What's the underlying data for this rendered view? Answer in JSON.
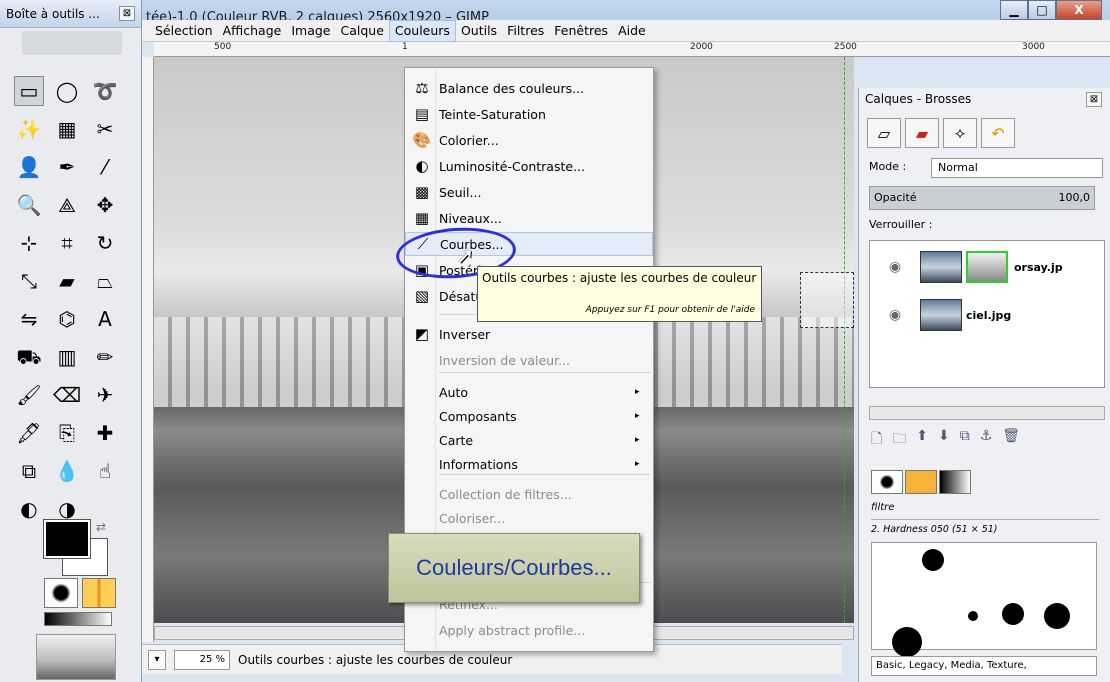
{
  "toolbox": {
    "title": "Boîte à outils ...",
    "close_glyph": "⊠",
    "tools": [
      {
        "name": "rect-select-icon",
        "glyph": "▭",
        "selected": true
      },
      {
        "name": "ellipse-select-icon",
        "glyph": "◯"
      },
      {
        "name": "lasso-icon",
        "glyph": "➰"
      },
      {
        "name": "fuzzy-select-icon",
        "glyph": "✨"
      },
      {
        "name": "color-select-icon",
        "glyph": "▦"
      },
      {
        "name": "scissors-icon",
        "glyph": "✂"
      },
      {
        "name": "foreground-select-icon",
        "glyph": "👤"
      },
      {
        "name": "paths-icon",
        "glyph": "✒"
      },
      {
        "name": "color-picker-icon",
        "glyph": "⁄"
      },
      {
        "name": "zoom-icon",
        "glyph": "🔍"
      },
      {
        "name": "measure-icon",
        "glyph": "⟁"
      },
      {
        "name": "move-icon",
        "glyph": "✥"
      },
      {
        "name": "align-icon",
        "glyph": "⊹"
      },
      {
        "name": "crop-icon",
        "glyph": "⌗"
      },
      {
        "name": "rotate-icon",
        "glyph": "↻"
      },
      {
        "name": "scale-icon",
        "glyph": "⤡"
      },
      {
        "name": "shear-icon",
        "glyph": "▰"
      },
      {
        "name": "perspective-icon",
        "glyph": "⏢"
      },
      {
        "name": "flip-icon",
        "glyph": "⇋"
      },
      {
        "name": "cage-icon",
        "glyph": "⌬"
      },
      {
        "name": "text-icon",
        "glyph": "A"
      },
      {
        "name": "bucket-fill-icon",
        "glyph": "⛟"
      },
      {
        "name": "blend-icon",
        "glyph": "▥"
      },
      {
        "name": "pencil-icon",
        "glyph": "✏"
      },
      {
        "name": "paintbrush-icon",
        "glyph": "🖌"
      },
      {
        "name": "eraser-icon",
        "glyph": "⌫"
      },
      {
        "name": "airbrush-icon",
        "glyph": "✈"
      },
      {
        "name": "ink-icon",
        "glyph": "🖋"
      },
      {
        "name": "clone-icon",
        "glyph": "⎘"
      },
      {
        "name": "heal-icon",
        "glyph": "✚"
      },
      {
        "name": "perspective-clone-icon",
        "glyph": "⧉"
      },
      {
        "name": "blur-icon",
        "glyph": "💧"
      },
      {
        "name": "smudge-icon",
        "glyph": "☝"
      },
      {
        "name": "dodge-burn-icon",
        "glyph": "◐"
      },
      {
        "name": "extra-tool-icon",
        "glyph": "◑"
      }
    ]
  },
  "window": {
    "title": "tée)-1.0 (Couleur RVB, 2 calques) 2560x1920 – GIMP",
    "minimize": "▁",
    "maximize": "□",
    "close": "X"
  },
  "menubar": [
    "Sélection",
    "Affichage",
    "Image",
    "Calque",
    "Couleurs",
    "Outils",
    "Filtres",
    "Fenêtres",
    "Aide"
  ],
  "ruler": {
    "labels": [
      "500",
      "1",
      "2000",
      "2500",
      "3000"
    ]
  },
  "colors_menu": {
    "items": [
      {
        "icon": "balance-icon",
        "glyph": "⚖",
        "label": "Balance des couleurs..."
      },
      {
        "icon": "hue-sat-icon",
        "glyph": "▤",
        "label": "Teinte-Saturation"
      },
      {
        "icon": "colorize-icon",
        "glyph": "🎨",
        "label": "Colorier..."
      },
      {
        "icon": "brightness-icon",
        "glyph": "◐",
        "label": "Luminosité-Contraste..."
      },
      {
        "icon": "threshold-icon",
        "glyph": "▩",
        "label": "Seuil..."
      },
      {
        "icon": "levels-icon",
        "glyph": "▦",
        "label": "Niveaux..."
      },
      {
        "icon": "curves-icon",
        "glyph": "⟋",
        "label": "Courbes...",
        "highlight": true
      },
      {
        "icon": "posterize-icon",
        "glyph": "▣",
        "label": "Postériser..."
      },
      {
        "icon": "desaturate-icon",
        "glyph": "▧",
        "label": "Désaturer..."
      },
      {
        "icon": "invert-icon",
        "glyph": "◩",
        "label": "Inverser"
      },
      {
        "icon": "",
        "glyph": "",
        "label": "Inversion de valeur...",
        "disabled": true
      },
      {
        "icon": "",
        "glyph": "",
        "label": "Auto",
        "submenu": true
      },
      {
        "icon": "",
        "glyph": "",
        "label": "Composants",
        "submenu": true
      },
      {
        "icon": "",
        "glyph": "",
        "label": "Carte",
        "submenu": true
      },
      {
        "icon": "",
        "glyph": "",
        "label": "Informations",
        "submenu": true
      },
      {
        "icon": "",
        "glyph": "",
        "label": "Collection de filtres...",
        "disabled": true
      },
      {
        "icon": "",
        "glyph": "",
        "label": "Coloriser...",
        "disabled": true
      },
      {
        "icon": "",
        "glyph": "",
        "label": "Retinex...",
        "disabled": true
      },
      {
        "icon": "",
        "glyph": "",
        "label": "Apply abstract profile...",
        "disabled": true
      }
    ],
    "submenu_arrow": "▸"
  },
  "tooltip": {
    "text": "Outils courbes : ajuste les courbes de couleur",
    "hint": "Appuyez sur F1 pour obtenir de l'aide"
  },
  "callout": "Couleurs/Courbes...",
  "status": {
    "zoom": "25 %",
    "message": "Outils courbes : ajuste les courbes de couleur",
    "arrow": "▾"
  },
  "dock": {
    "title": "Calques - Brosses",
    "mode_label": "Mode :",
    "mode_value": "Normal",
    "opacity_label": "Opacité",
    "opacity_value": "100,0",
    "lock_label": "Verrouiller :",
    "layers": [
      {
        "name": "orsay.jp",
        "has_mask": true
      },
      {
        "name": "ciel.jpg",
        "has_mask": false
      }
    ],
    "filter_placeholder": "filtre",
    "brush_name": "2. Hardness 050 (51 × 51)",
    "tags": "Basic, Legacy, Media, Texture,"
  }
}
